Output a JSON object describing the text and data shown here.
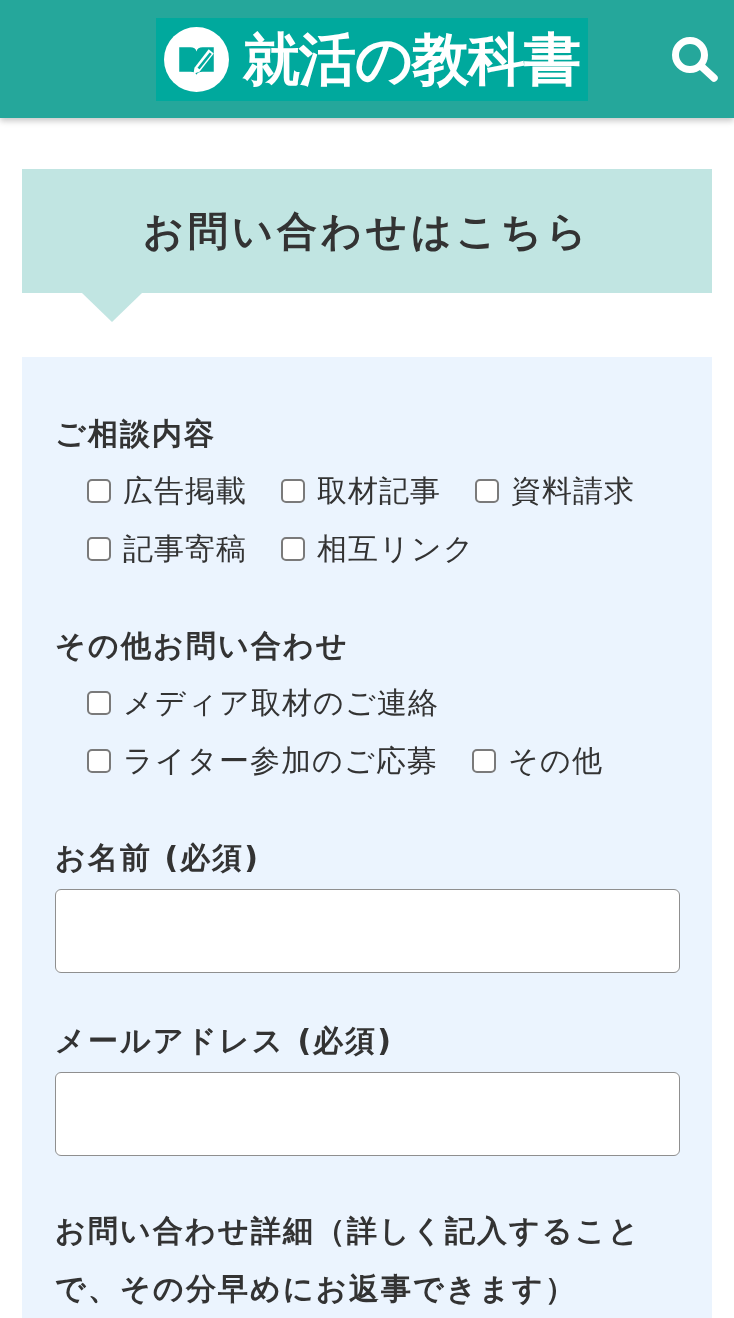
{
  "header": {
    "logo": "就活の教科書"
  },
  "banner": {
    "title": "お問い合わせはこちら"
  },
  "form": {
    "groups": [
      {
        "kind": "checkboxes",
        "label": "ご相談内容",
        "options": [
          {
            "label": "広告掲載",
            "checked": false
          },
          {
            "label": "取材記事",
            "checked": false
          },
          {
            "label": "資料請求",
            "checked": false
          },
          {
            "label": "記事寄稿",
            "checked": false
          },
          {
            "label": "相互リンク",
            "checked": false
          }
        ]
      },
      {
        "kind": "checkboxes",
        "label": "その他お問い合わせ",
        "options": [
          {
            "label": "メディア取材のご連絡",
            "checked": false
          },
          {
            "label": "ライター参加のご応募",
            "checked": false
          },
          {
            "label": "その他",
            "checked": false
          }
        ]
      },
      {
        "kind": "text_input",
        "label": "お名前 (必須)"
      },
      {
        "kind": "text_input",
        "label": "メールアドレス (必須)"
      },
      {
        "kind": "heading",
        "label": "お問い合わせ詳細（詳しく記入することで、その分早めにお返事できます）"
      }
    ]
  }
}
